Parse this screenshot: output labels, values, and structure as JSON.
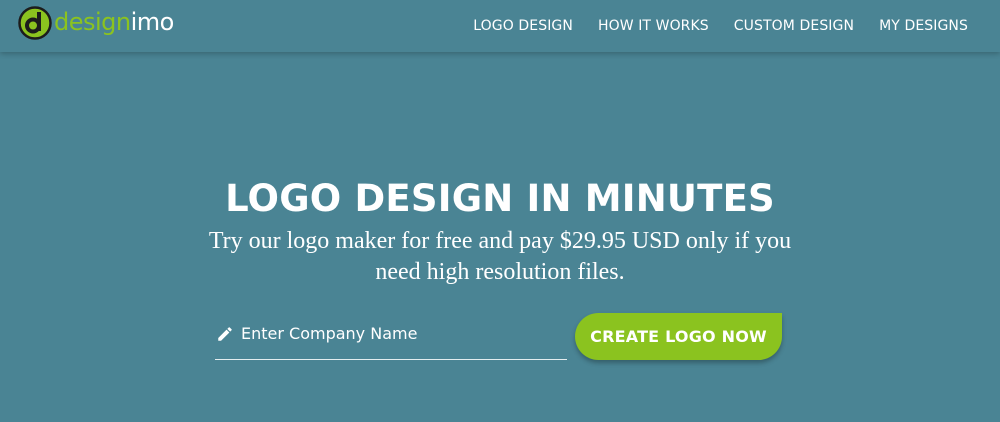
{
  "brand": {
    "name_part1": "design",
    "name_part2": "imo",
    "accent_color": "#8bc31f",
    "background_color": "#4a8494"
  },
  "nav": {
    "items": [
      {
        "label": "LOGO DESIGN"
      },
      {
        "label": "HOW IT WORKS"
      },
      {
        "label": "CUSTOM DESIGN"
      },
      {
        "label": "MY DESIGNS"
      }
    ]
  },
  "hero": {
    "title": "LOGO DESIGN IN MINUTES",
    "subtitle": "Try our logo maker for free and pay $29.95 USD only if you need high resolution files."
  },
  "form": {
    "icon": "pencil-icon",
    "company_placeholder": "Enter Company Name",
    "company_value": "",
    "submit_label": "CREATE LOGO NOW"
  }
}
